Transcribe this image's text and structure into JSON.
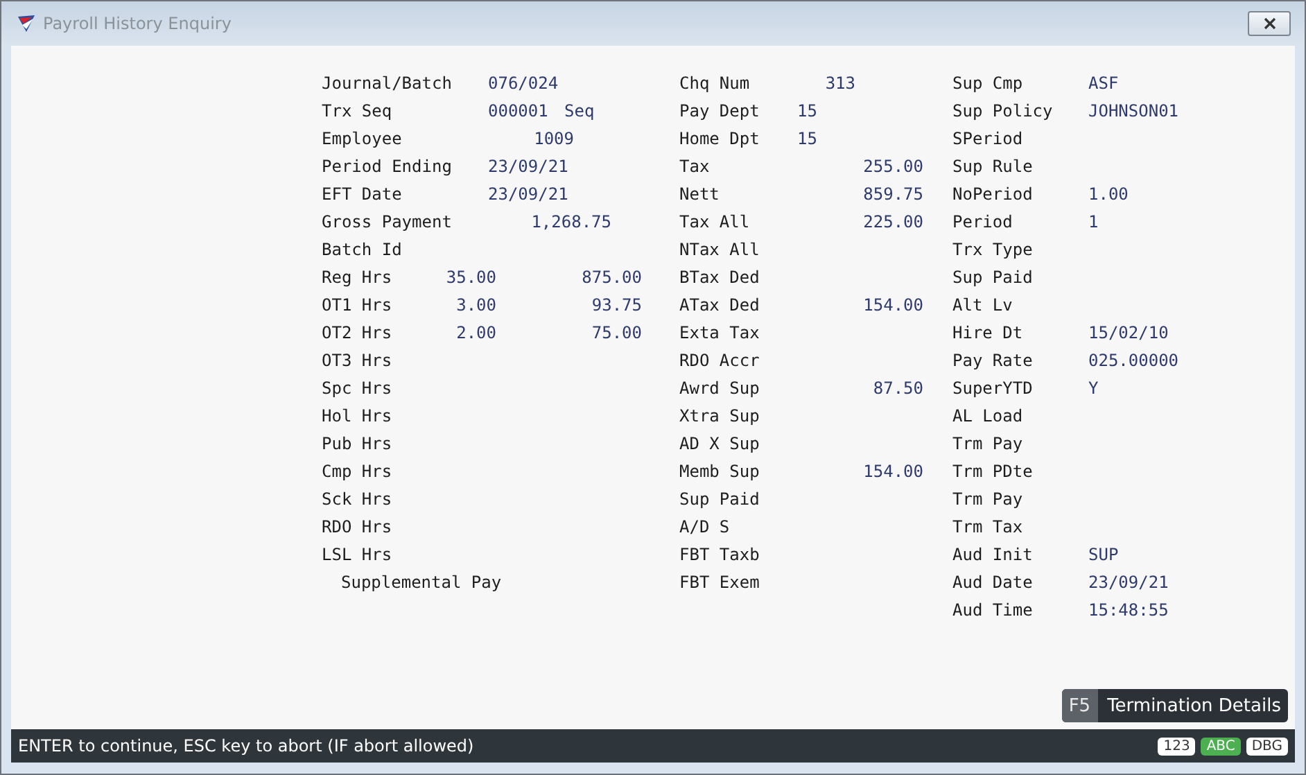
{
  "window": {
    "title": "Payroll History Enquiry"
  },
  "columns": [
    {
      "fields": [
        {
          "label": "Journal/Batch",
          "kind": "text",
          "values": [
            "076/024"
          ]
        },
        {
          "label": "Trx Seq",
          "kind": "seq",
          "values": [
            "000001",
            "Seq"
          ]
        },
        {
          "label": "Employee",
          "kind": "count",
          "values": [
            "1009"
          ]
        },
        {
          "label": "Period Ending",
          "kind": "text",
          "values": [
            "23/09/21"
          ]
        },
        {
          "label": "EFT Date",
          "kind": "text",
          "values": [
            "23/09/21"
          ]
        },
        {
          "label": "Gross Payment",
          "kind": "total",
          "values": [
            "1,268.75"
          ]
        },
        {
          "label": "Batch Id",
          "kind": "label"
        },
        {
          "label": "Reg Hrs",
          "kind": "hours",
          "values": [
            "35.00",
            "875.00"
          ]
        },
        {
          "label": "OT1 Hrs",
          "kind": "hours",
          "values": [
            "3.00",
            "93.75"
          ]
        },
        {
          "label": "OT2 Hrs",
          "kind": "hours",
          "values": [
            "2.00",
            "75.00"
          ]
        },
        {
          "label": "OT3 Hrs",
          "kind": "label"
        },
        {
          "label": "Spc Hrs",
          "kind": "label"
        },
        {
          "label": "Hol Hrs",
          "kind": "label"
        },
        {
          "label": "Pub Hrs",
          "kind": "label"
        },
        {
          "label": "Cmp Hrs",
          "kind": "label"
        },
        {
          "label": "Sck Hrs",
          "kind": "label"
        },
        {
          "label": "RDO Hrs",
          "kind": "label"
        },
        {
          "label": "LSL Hrs",
          "kind": "label"
        },
        {
          "label": "Supplemental Pay",
          "kind": "heading"
        }
      ]
    },
    {
      "fields": [
        {
          "label": "Chq Num",
          "kind": "cheque",
          "values": [
            "313"
          ]
        },
        {
          "label": "Pay Dept",
          "kind": "text",
          "values": [
            "15"
          ]
        },
        {
          "label": "Home Dpt",
          "kind": "text",
          "values": [
            "15"
          ]
        },
        {
          "label": "Tax",
          "kind": "amount",
          "values": [
            "255.00"
          ]
        },
        {
          "label": "Nett",
          "kind": "amount",
          "values": [
            "859.75"
          ]
        },
        {
          "label": "Tax All",
          "kind": "amount",
          "values": [
            "225.00"
          ]
        },
        {
          "label": "NTax All",
          "kind": "label"
        },
        {
          "label": "BTax Ded",
          "kind": "label"
        },
        {
          "label": "ATax Ded",
          "kind": "amount",
          "values": [
            "154.00"
          ]
        },
        {
          "label": "Exta Tax",
          "kind": "label"
        },
        {
          "label": "RDO Accr",
          "kind": "label"
        },
        {
          "label": "Awrd Sup",
          "kind": "amount",
          "values": [
            "87.50"
          ]
        },
        {
          "label": "Xtra Sup",
          "kind": "label"
        },
        {
          "label": "AD X Sup",
          "kind": "label"
        },
        {
          "label": "Memb Sup",
          "kind": "amount",
          "values": [
            "154.00"
          ]
        },
        {
          "label": "Sup Paid",
          "kind": "label"
        },
        {
          "label": "A/D S",
          "kind": "label"
        },
        {
          "label": "FBT Taxb",
          "kind": "label"
        },
        {
          "label": "FBT Exem",
          "kind": "label"
        }
      ]
    },
    {
      "fields": [
        {
          "label": "Sup Cmp",
          "kind": "text",
          "values": [
            "ASF"
          ]
        },
        {
          "label": "Sup Policy",
          "kind": "text",
          "values": [
            "JOHNSON01"
          ]
        },
        {
          "label": "SPeriod",
          "kind": "label"
        },
        {
          "label": "Sup Rule",
          "kind": "label"
        },
        {
          "label": "NoPeriod",
          "kind": "text",
          "values": [
            "1.00"
          ]
        },
        {
          "label": "Period",
          "kind": "text",
          "values": [
            "1"
          ]
        },
        {
          "label": "Trx Type",
          "kind": "label"
        },
        {
          "label": "Sup Paid",
          "kind": "label"
        },
        {
          "label": "Alt Lv",
          "kind": "label"
        },
        {
          "label": "Hire Dt",
          "kind": "text",
          "values": [
            "15/02/10"
          ]
        },
        {
          "label": "Pay Rate",
          "kind": "text",
          "values": [
            "025.00000"
          ]
        },
        {
          "label": "SuperYTD",
          "kind": "text",
          "values": [
            "Y"
          ]
        },
        {
          "label": "AL Load",
          "kind": "label"
        },
        {
          "label": "Trm Pay",
          "kind": "label"
        },
        {
          "label": "Trm PDte",
          "kind": "label"
        },
        {
          "label": "Trm Pay",
          "kind": "label"
        },
        {
          "label": "Trm Tax",
          "kind": "label"
        },
        {
          "label": "Aud Init",
          "kind": "text",
          "values": [
            "SUP"
          ]
        },
        {
          "label": "Aud Date",
          "kind": "text",
          "values": [
            "23/09/21"
          ]
        },
        {
          "label": "Aud Time",
          "kind": "text",
          "values": [
            "15:48:55"
          ]
        }
      ]
    }
  ],
  "function_key": {
    "key": "F5",
    "label": "Termination Details"
  },
  "status_bar": {
    "message": "ENTER to continue, ESC key to abort (IF abort allowed)",
    "indicators": [
      {
        "label": "123",
        "selected": false
      },
      {
        "label": "ABC",
        "selected": true
      },
      {
        "label": "DBG",
        "selected": false
      }
    ]
  }
}
